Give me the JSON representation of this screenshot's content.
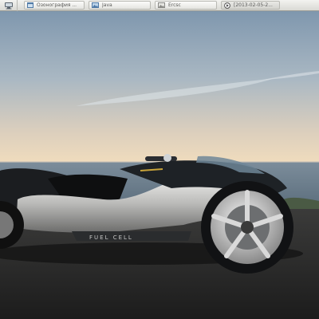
{
  "taskbar": {
    "tasks": [
      {
        "label": "Озонография ...",
        "icon": "window-icon"
      },
      {
        "label": "Java",
        "icon": "image-icon"
      },
      {
        "label": "Ercsc",
        "icon": "image-icon"
      },
      {
        "label": "[2013-02-05-2...",
        "icon": "media-icon"
      }
    ]
  },
  "wallpaper": {
    "decal_label": "FUEL CELL",
    "colors": {
      "sky_top": "#7f97ae",
      "horizon": "#f0dcbd",
      "sea": "#6d7f8e",
      "road": "#2a2a2a"
    }
  }
}
